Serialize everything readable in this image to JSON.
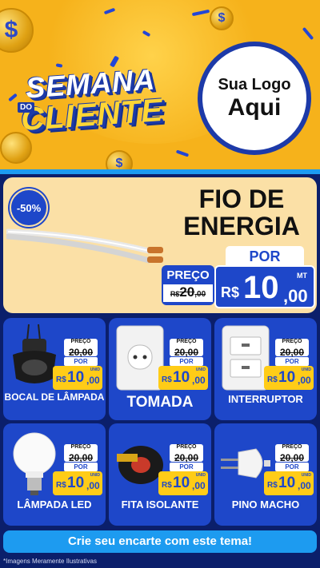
{
  "header": {
    "title_word1": "SEMANA",
    "title_small": "DO",
    "title_word2": "CLIENTE",
    "logo_line1": "Sua Logo",
    "logo_line2": "Aqui",
    "coin_symbol": "$"
  },
  "main_offer": {
    "discount_badge": "-50%",
    "product_name": "FIO DE ENERGIA",
    "por_label": "POR",
    "preco_label": "PREÇO",
    "old_price_currency": "R$",
    "old_price_int": "20",
    "old_price_dec": ",00",
    "new_price_unit": "MT",
    "new_price_currency": "R$",
    "new_price_int": "10",
    "new_price_dec": ",00"
  },
  "price_labels": {
    "preco": "PREÇO",
    "por": "POR",
    "currency": "R$",
    "unit": "UNID",
    "old_int": "20",
    "old_dec": ",00",
    "new_int": "10",
    "new_dec": ",00"
  },
  "products": [
    {
      "name": "BOCAL DE LÂMPADA",
      "icon": "socket-icon"
    },
    {
      "name": "TOMADA",
      "icon": "outlet-icon"
    },
    {
      "name": "INTERRUPTOR",
      "icon": "switch-icon"
    },
    {
      "name": "LÂMPADA LED",
      "icon": "bulb-icon"
    },
    {
      "name": "FITA ISOLANTE",
      "icon": "tape-icon"
    },
    {
      "name": "PINO MACHO",
      "icon": "plug-icon"
    }
  ],
  "cta": "Crie seu encarte com este tema!",
  "footnote": "*Imagens Meramente Ilustrativas",
  "colors": {
    "brand_blue": "#1e47c9",
    "accent_yellow": "#ffcc17",
    "header_bg": "#f6b21b",
    "cta_blue": "#1d9bf0"
  }
}
